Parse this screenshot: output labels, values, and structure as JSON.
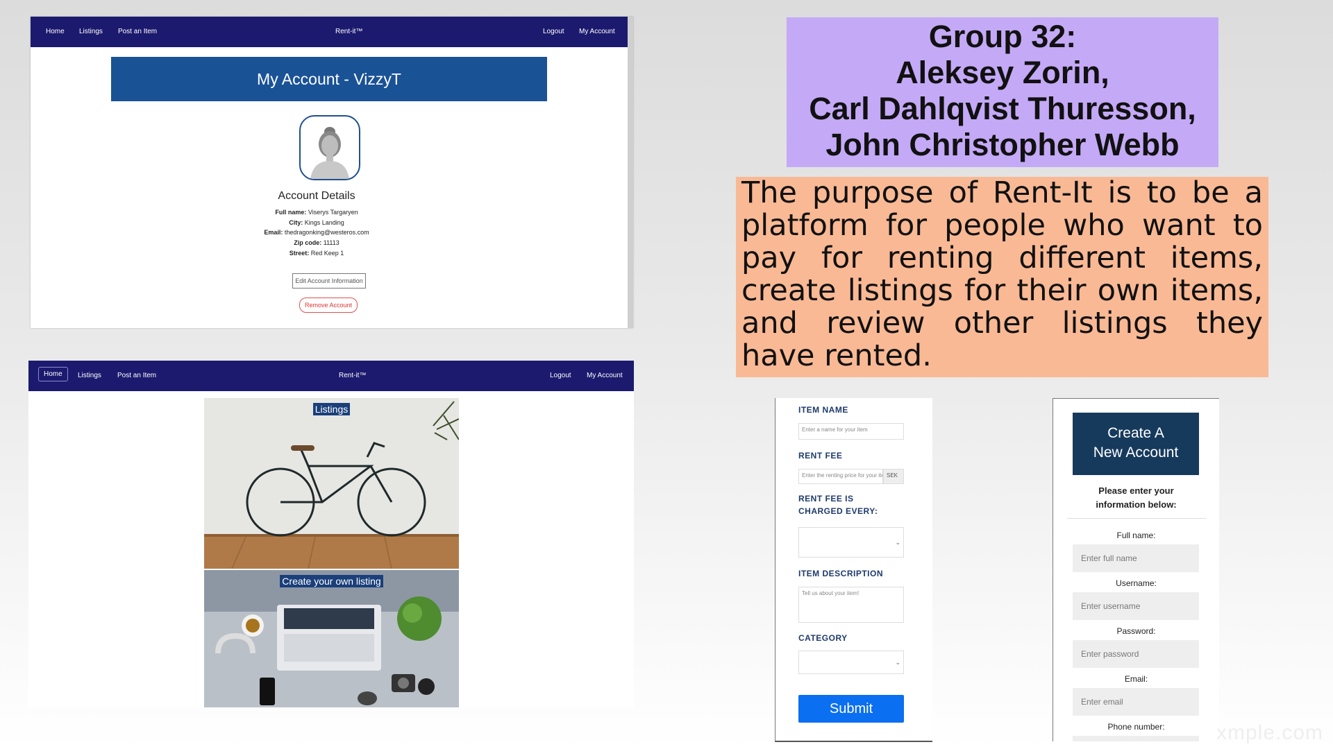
{
  "account_shot": {
    "nav": {
      "home": "Home",
      "listings": "Listings",
      "post": "Post an Item",
      "brand": "Rent-it™",
      "logout": "Logout",
      "account": "My Account"
    },
    "banner": "My Account - VizzyT",
    "details_title": "Account Details",
    "details": [
      {
        "label": "Full name:",
        "value": " Viserys Targaryen"
      },
      {
        "label": "City:",
        "value": " Kings Landing"
      },
      {
        "label": "Email:",
        "value": " thedragonking@westeros.com"
      },
      {
        "label": "Zip code:",
        "value": " 11113"
      },
      {
        "label": "Street:",
        "value": " Red Keep 1"
      }
    ],
    "edit_button": "Edit Account Information",
    "remove_button": "Remove Account"
  },
  "home_shot": {
    "nav": {
      "home": "Home",
      "listings": "Listings",
      "post": "Post an Item",
      "brand": "Rent-it™",
      "logout": "Logout",
      "account": "My Account"
    },
    "tiles": [
      {
        "label": "Listings"
      },
      {
        "label": "Create your own listing"
      }
    ]
  },
  "group_title": [
    "Group 32:",
    "Aleksey Zorin,",
    "Carl Dahlqvist Thuresson,",
    "John Christopher Webb"
  ],
  "description": "The purpose of Rent-It is to be a platform for people who want to pay for renting different items, create listings for their own items, and review other listings they have rented.",
  "item_form": {
    "item_name_label": "ITEM NAME",
    "item_name_placeholder": "Enter a name for your item",
    "rent_fee_label": "RENT FEE",
    "rent_fee_placeholder": "Enter the renting price for your item",
    "currency": "SEK",
    "charged_label_1": "RENT FEE IS",
    "charged_label_2": "CHARGED EVERY:",
    "description_label": "ITEM DESCRIPTION",
    "description_placeholder": "Tell us about your item!",
    "category_label": "CATEGORY",
    "submit": "Submit"
  },
  "signup_form": {
    "title_1": "Create A",
    "title_2": "New Account",
    "intro_1": "Please enter your",
    "intro_2": "information below:",
    "fields": [
      {
        "label": "Full name:",
        "placeholder": "Enter full name"
      },
      {
        "label": "Username:",
        "placeholder": "Enter username"
      },
      {
        "label": "Password:",
        "placeholder": "Enter password"
      },
      {
        "label": "Email:",
        "placeholder": "Enter email"
      },
      {
        "label": "Phone number:"
      }
    ]
  },
  "watermark": "xmple.com",
  "colors": {
    "navbar": "#1c1a6e",
    "banner": "#1a5296",
    "group_box": "#c4a9f7",
    "desc_box": "#f9b994",
    "submit": "#0a6ff0",
    "signup_head": "#163a5c"
  }
}
